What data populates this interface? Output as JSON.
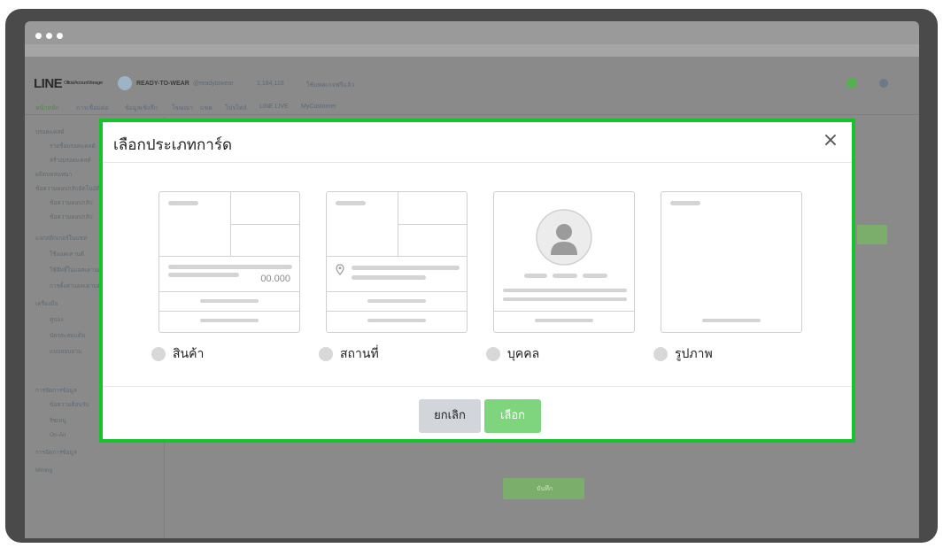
{
  "background": {
    "brand": "LINE",
    "brand_small": "Official Account Manager",
    "account_name": "READY-TO-WEAR",
    "account_id": "@readytowear",
    "header_meta": [
      "1,184,118",
      "ใช้แพคเกจฟรีแล้ว",
      "สิทธิ์"
    ],
    "nav_tabs": [
      "หน้าหลัก",
      "การเชื่อมต่อ",
      "ข้อมูลเชิงลึก",
      "โฆษณา",
      "แชต",
      "โปรไฟล์",
      "LINE LIVE",
      "MyCustomer"
    ],
    "sidebar_items": [
      "บรอดแคสต์",
      "รายชื่อบรอดแคสต์",
      "สร้างบรอดแคสต์",
      "ผลิตบทสนทนา",
      "ข้อความตอบกลับอัตโนมัติ",
      "ข้อความตอบกลับ",
      "ข้อความตอบกลับ",
      "แจกสติกเกอร์ในแชท",
      "ใช้แอคเคานต์",
      "ใช้สิทธิ์ในแอคเคานต์",
      "การตั้งค่าแอคเคานต์",
      "เครื่องมือ",
      "คูปอง",
      "บัตรสะสมแต้ม",
      "แบบสอบถาม",
      "การจัดการข้อมูล",
      "ข้อความต้อนรับ",
      "ริชเมนู",
      "On-Air",
      "การจัดการข้อมูล",
      "Mining"
    ],
    "bottom_button": "บันทึก"
  },
  "modal": {
    "title": "เลือกประเภทการ์ด",
    "close_symbol": "×",
    "cards": [
      {
        "id": "product",
        "label": "สินค้า",
        "price": "00.000"
      },
      {
        "id": "location",
        "label": "สถานที่"
      },
      {
        "id": "person",
        "label": "บุคคล"
      },
      {
        "id": "image",
        "label": "รูปภาพ"
      }
    ],
    "cancel_label": "ยกเลิก",
    "confirm_label": "เลือก"
  },
  "colors": {
    "highlight_border": "#16c32a",
    "confirm_button": "#7fd47e",
    "cancel_button": "#d2d5da"
  }
}
